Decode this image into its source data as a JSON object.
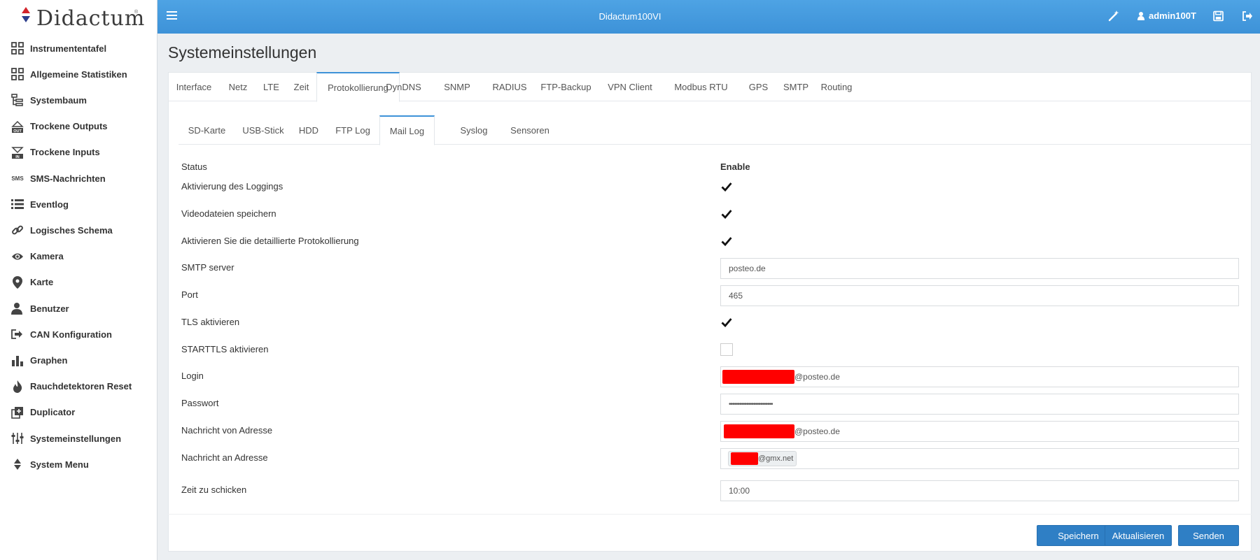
{
  "topbar": {
    "logo_text": "Didactum",
    "logo_trademark": "®",
    "device_name": "Didactum100VI",
    "username": "admin100T",
    "icons": [
      "menu-icon",
      "magic-wand-icon",
      "user-icon",
      "save-icon",
      "logout-icon"
    ]
  },
  "sidebar": {
    "items": [
      {
        "label": "Instrumententafel",
        "icon": "dashboard-icon"
      },
      {
        "label": "Allgemeine Statistiken",
        "icon": "dashboard-icon"
      },
      {
        "label": "Systembaum",
        "icon": "tree-icon"
      },
      {
        "label": "Trockene Outputs",
        "icon": "out-icon"
      },
      {
        "label": "Trockene Inputs",
        "icon": "in-icon"
      },
      {
        "label": "SMS-Nachrichten",
        "icon": "sms-icon",
        "icon_text": "SMS"
      },
      {
        "label": "Eventlog",
        "icon": "list-icon"
      },
      {
        "label": "Logisches Schema",
        "icon": "link-icon"
      },
      {
        "label": "Kamera",
        "icon": "eye-icon"
      },
      {
        "label": "Karte",
        "icon": "map-marker-icon"
      },
      {
        "label": "Benutzer",
        "icon": "user-icon"
      },
      {
        "label": "CAN Konfiguration",
        "icon": "sign-in-icon"
      },
      {
        "label": "Graphen",
        "icon": "bar-chart-icon"
      },
      {
        "label": "Rauchdetektoren Reset",
        "icon": "fire-icon"
      },
      {
        "label": "Duplicator",
        "icon": "copy-icon"
      },
      {
        "label": "Systemeinstellungen",
        "icon": "sliders-icon"
      },
      {
        "label": "System Menu",
        "icon": "sort-icon"
      }
    ]
  },
  "page": {
    "title": "Systemeinstellungen"
  },
  "main_tabs": [
    {
      "label": "Interface",
      "active": false
    },
    {
      "label": "Netz",
      "active": false
    },
    {
      "label": "LTE",
      "active": false
    },
    {
      "label": "Zeit",
      "active": false
    },
    {
      "label": "Protokollierung",
      "active": true
    },
    {
      "label": "DynDNS",
      "active": false
    },
    {
      "label": "SNMP",
      "active": false
    },
    {
      "label": "RADIUS",
      "active": false
    },
    {
      "label": "FTP-Backup",
      "active": false
    },
    {
      "label": "VPN Client",
      "active": false
    },
    {
      "label": "Modbus RTU",
      "active": false
    },
    {
      "label": "GPS",
      "active": false
    },
    {
      "label": "SMTP",
      "active": false
    },
    {
      "label": "Routing",
      "active": false
    }
  ],
  "sub_tabs": [
    {
      "label": "SD-Karte",
      "active": false
    },
    {
      "label": "USB-Stick",
      "active": false
    },
    {
      "label": "HDD",
      "active": false
    },
    {
      "label": "FTP Log",
      "active": false
    },
    {
      "label": "Mail Log",
      "active": true
    },
    {
      "label": "Syslog",
      "active": false
    },
    {
      "label": "Sensoren",
      "active": false
    }
  ],
  "form": {
    "status_label": "Status",
    "status_value": "Enable",
    "logging_label": "Aktivierung des Loggings",
    "logging_checked": true,
    "video_label": "Videodateien speichern",
    "video_checked": true,
    "detailed_label": "Aktivieren Sie die detaillierte Protokollierung",
    "detailed_checked": true,
    "smtp_label": "SMTP server",
    "smtp_value": "posteo.de",
    "port_label": "Port",
    "port_value": "465",
    "tls_label": "TLS aktivieren",
    "tls_checked": true,
    "starttls_label": "STARTTLS aktivieren",
    "starttls_checked": false,
    "login_label": "Login",
    "login_suffix": "@posteo.de",
    "password_label": "Passwort",
    "password_value": "•••••••••••••••••••••••••",
    "from_label": "Nachricht von Adresse",
    "from_suffix": "@posteo.de",
    "to_label": "Nachricht an Adresse",
    "to_tag_suffix": "@gmx.net",
    "time_label": "Zeit zu schicken",
    "time_value": "10:00"
  },
  "buttons": {
    "save": "Speichern",
    "refresh": "Aktualisieren",
    "send": "Senden"
  },
  "colors": {
    "topbar": "#3d92d8",
    "button": "#2f7fc5",
    "redaction": "#ff0000"
  }
}
